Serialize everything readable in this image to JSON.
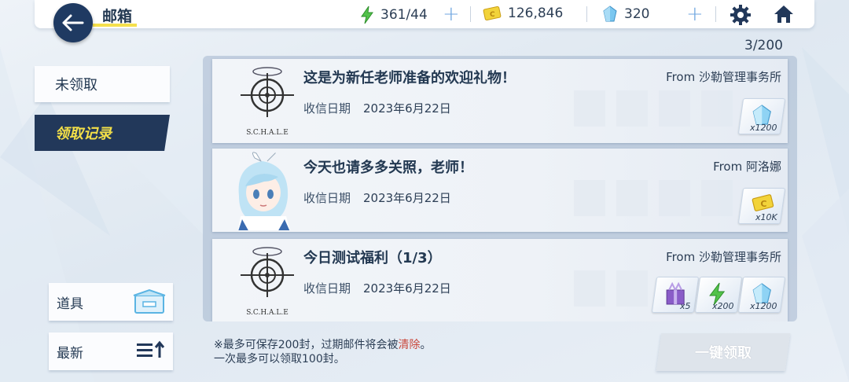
{
  "header": {
    "title": "邮箱",
    "ap": "361/44",
    "credits": "126,846",
    "pyroxene": "320"
  },
  "mail_count": "3/200",
  "tabs": {
    "unclaimed": "未领取",
    "history": "领取记录"
  },
  "side": {
    "items_label": "道具",
    "sort_label": "最新"
  },
  "mails": [
    {
      "subject": "这是为新任老师准备的欢迎礼物！",
      "sender": "From 沙勒管理事务所",
      "date_label": "收信日期",
      "date": "2023年6月22日",
      "avatar_caption": "S.C.H.A.L.E",
      "rewards": [
        {
          "icon": "pyroxene-icon",
          "qty": "x1200"
        }
      ]
    },
    {
      "subject": "今天也请多多关照，老师！",
      "sender": "From 阿洛娜",
      "date_label": "收信日期",
      "date": "2023年6月22日",
      "rewards": [
        {
          "icon": "credit-icon",
          "qty": "x10K"
        }
      ]
    },
    {
      "subject": "今日测试福利（1/3）",
      "sender": "From 沙勒管理事务所",
      "date_label": "收信日期",
      "date": "2023年6月22日",
      "avatar_caption": "S.C.H.A.L.E",
      "rewards": [
        {
          "icon": "gift-box-icon",
          "qty": "x5"
        },
        {
          "icon": "ap-icon",
          "qty": "x200"
        },
        {
          "icon": "pyroxene-icon",
          "qty": "x1200"
        }
      ]
    }
  ],
  "footer": {
    "note_prefix": "※最多可保存200封，过期邮件将会被",
    "note_warn": "清除",
    "note_suffix": "。",
    "note_line2": "一次最多可以领取100封。",
    "claim_all": "一键领取"
  },
  "colors": {
    "navy": "#22385a",
    "highlight_yellow": "#f3df48",
    "warning_red": "#c9473b",
    "plus_blue": "#6fa6e0"
  }
}
